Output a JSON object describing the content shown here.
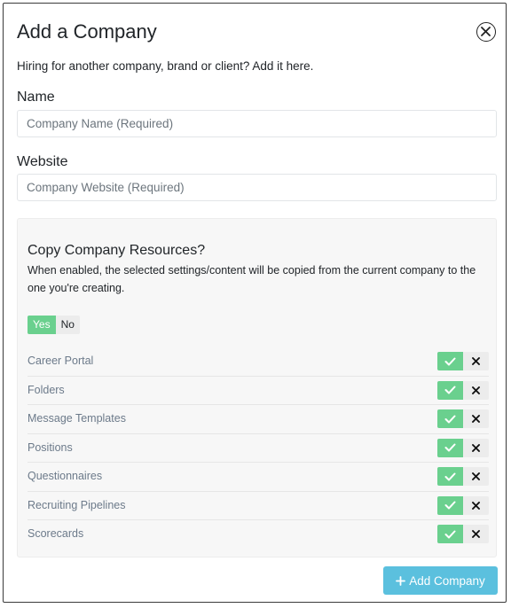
{
  "modal": {
    "title": "Add a Company",
    "subtitle": "Hiring for another company, brand or client? Add it here."
  },
  "form": {
    "name_label": "Name",
    "name_placeholder": "Company Name (Required)",
    "website_label": "Website",
    "website_placeholder": "Company Website (Required)"
  },
  "copy_panel": {
    "title": "Copy Company Resources?",
    "description": "When enabled, the selected settings/content will be copied from the current company to the one you're creating.",
    "toggle_yes": "Yes",
    "toggle_no": "No",
    "toggle_selected": "Yes",
    "resources": [
      {
        "label": "Career Portal",
        "selected": true
      },
      {
        "label": "Folders",
        "selected": true
      },
      {
        "label": "Message Templates",
        "selected": true
      },
      {
        "label": "Positions",
        "selected": true
      },
      {
        "label": "Questionnaires",
        "selected": true
      },
      {
        "label": "Recruiting Pipelines",
        "selected": true
      },
      {
        "label": "Scorecards",
        "selected": true
      }
    ]
  },
  "footer": {
    "add_button_label": "Add Company"
  },
  "colors": {
    "accent_green": "#6ad08e",
    "button_blue": "#5bc0de"
  },
  "icons": {
    "close": "close-circle-icon",
    "check": "check-icon",
    "x": "x-icon",
    "plus": "plus-icon"
  }
}
